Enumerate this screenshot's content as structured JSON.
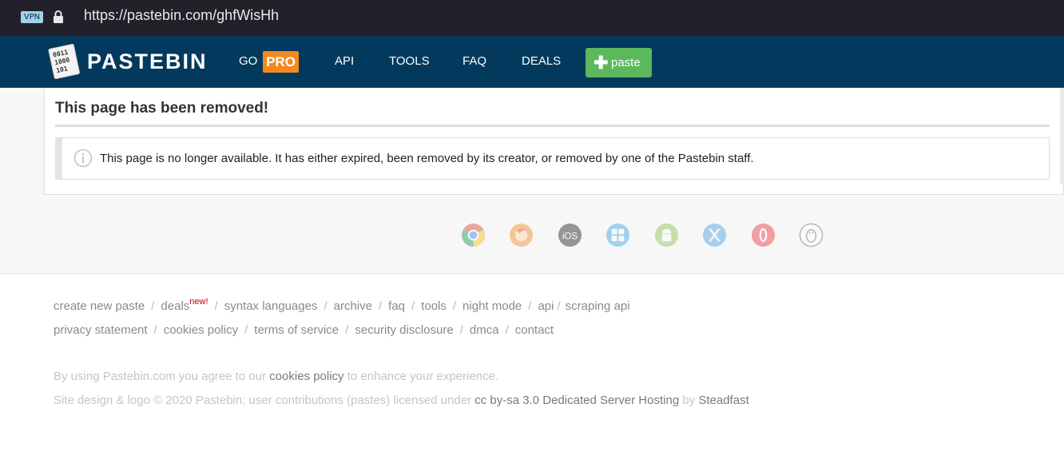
{
  "browser": {
    "vpn_badge": "VPN",
    "url": "https://pastebin.com/ghfWisHh"
  },
  "header": {
    "logo_icon_text": [
      "0011",
      "1000",
      "101"
    ],
    "logo_text": "PASTEBIN",
    "nav": {
      "go": "GO",
      "pro": "PRO",
      "api": "API",
      "tools": "TOOLS",
      "faq": "FAQ",
      "deals": "DEALS"
    },
    "paste_button": {
      "icon": "plus-icon",
      "label": "paste"
    },
    "colors": {
      "header_bg": "#02395c",
      "pro_bg": "#f5891f",
      "paste_bg": "#5cb85c"
    }
  },
  "content": {
    "title": "This page has been removed!",
    "notice_icon": "info-circle-icon",
    "notice_text": "This page is no longer available. It has either expired, been removed by its creator, or removed by one of the Pastebin staff."
  },
  "platform_icons": [
    "chrome-icon",
    "firefox-icon",
    "ios-icon",
    "windows-icon",
    "android-icon",
    "macos-icon",
    "opera-icon",
    "linux-icon"
  ],
  "platform_ios_label": "iOS",
  "footer": {
    "links_row1": [
      "create new paste",
      "deals",
      "syntax languages",
      "archive",
      "faq",
      "tools",
      "night mode",
      "api",
      "scraping api"
    ],
    "deals_badge": "new!",
    "links_row2": [
      "privacy statement",
      "cookies policy",
      "terms of service",
      "security disclosure",
      "dmca",
      "contact"
    ],
    "separator": "/",
    "cookie_notice": {
      "pre": "By using Pastebin.com you agree to our",
      "link": "cookies policy",
      "post": "to enhance your experience."
    },
    "license": {
      "pre": "Site design & logo © 2020 Pastebin; user contributions (pastes) licensed under",
      "cc_link": "cc by-sa 3.0",
      "hosting_link": "Dedicated Server Hosting",
      "by": "by",
      "steadfast_link": "Steadfast"
    }
  }
}
